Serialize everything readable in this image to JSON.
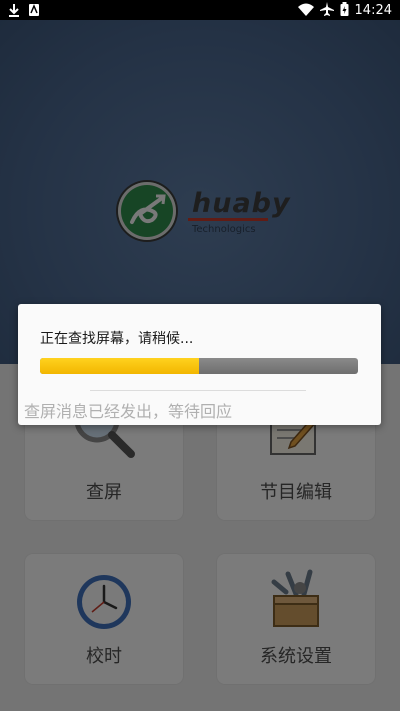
{
  "status_bar": {
    "left_icons": [
      "download-icon",
      "notification-icon"
    ],
    "right_icons": [
      "wifi-icon",
      "airplane-icon",
      "battery-icon"
    ],
    "time": "14:24"
  },
  "logo": {
    "name": "huaby",
    "subtitle": "Technologics",
    "colors": {
      "circle": "#2e8b4a",
      "underline": "#c0392b"
    }
  },
  "menu": {
    "items": [
      {
        "label": "查屏",
        "icon": "search-icon"
      },
      {
        "label": "节目编辑",
        "icon": "edit-document-icon"
      },
      {
        "label": "校时",
        "icon": "clock-icon"
      },
      {
        "label": "系统设置",
        "icon": "toolbox-icon"
      }
    ]
  },
  "dialog": {
    "message": "正在查找屏幕，请稍候...",
    "progress_fraction": 0.5,
    "sub_message": "查屏消息已经发出，等待回应",
    "colors": {
      "progress_fill": "#f7c300",
      "progress_track": "#7a7a7a"
    }
  }
}
